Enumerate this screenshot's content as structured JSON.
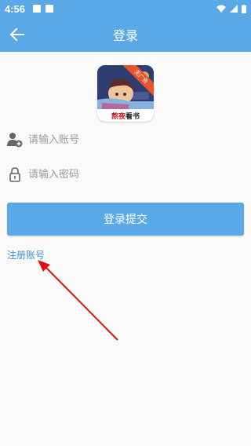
{
  "status_bar": {
    "time": "4:56"
  },
  "app_bar": {
    "title": "登录",
    "back_icon": "arrow-left-icon"
  },
  "logo": {
    "caption_hot": "熬夜",
    "caption_rest": "看书",
    "ribbon": "无广告"
  },
  "account_field": {
    "placeholder": "请输入账号",
    "icon": "user-add-icon"
  },
  "password_field": {
    "placeholder": "请输入密码",
    "icon": "lock-icon"
  },
  "submit_button": {
    "label": "登录提交"
  },
  "register_link": {
    "label": "注册账号"
  },
  "colors": {
    "primary": "#5aa8e6",
    "link": "#3d94d4",
    "annotation_arrow": "#e01010"
  }
}
